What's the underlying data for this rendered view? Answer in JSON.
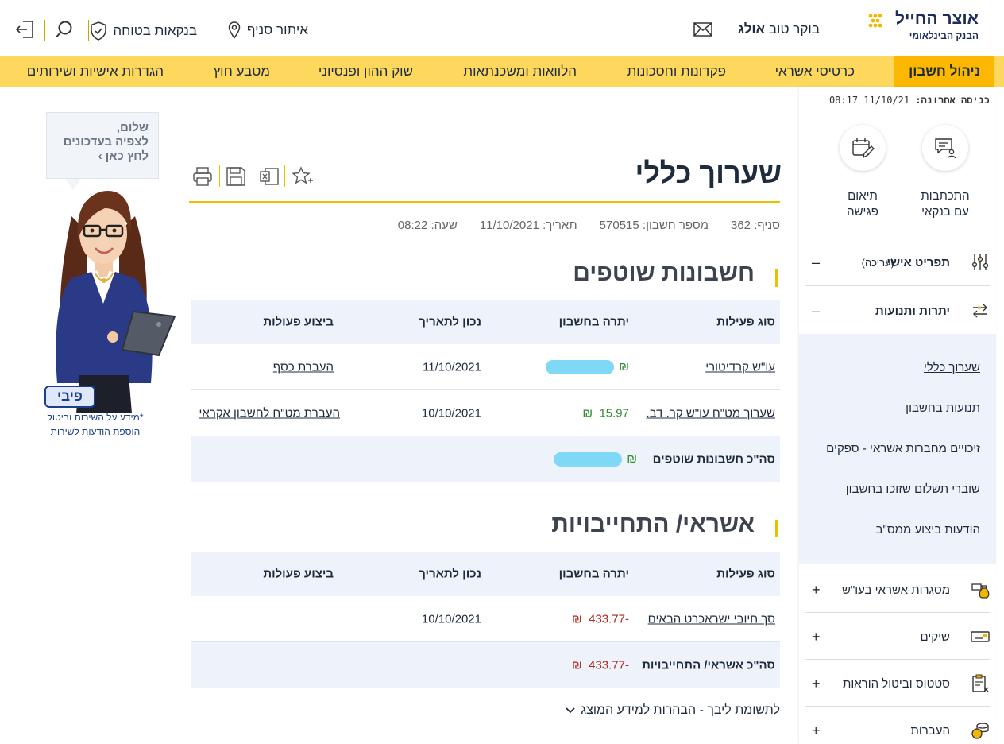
{
  "header": {
    "logo_name": "אוצר החייל",
    "logo_sub": "הבנק הבינלאומי",
    "greeting_prefix": "בוקר טוב",
    "user_name": "אולג",
    "branch_locator": "איתור סניף",
    "secure_banking": "בנקאות בטוחה"
  },
  "nav": {
    "items": [
      "ניהול חשבון",
      "כרטיסי אשראי",
      "פקדונות וחסכונות",
      "הלוואות ומשכנתאות",
      "שוק ההון ופנסיוני",
      "מטבע חוץ",
      "הגדרות אישיות ושירותים"
    ]
  },
  "sidebar": {
    "last_login_label": "כניסה אחרונה:",
    "last_login_date": "11/10/21",
    "last_login_time": "08:17",
    "quick_actions": [
      {
        "line1": "התכתבות",
        "line2": "עם בנקאי",
        "icon": "chat-banker-icon"
      },
      {
        "line1": "תיאום",
        "line2": "פגישה",
        "icon": "calendar-edit-icon"
      }
    ],
    "personal_menu": "תפריט אישי",
    "personal_edit": "(עריכה)",
    "balances": "יתרות ותנועות",
    "submenu": [
      "שערוך כללי",
      "תנועות בחשבון",
      "זיכויים מחברות אשראי - ספקים",
      "שוברי תשלום שזוכו בחשבון",
      "הודעות ביצוע ממס\"ב"
    ],
    "groups": [
      "מסגרות אשראי בעו\"ש",
      "שיקים",
      "סטטוס וביטול הוראות",
      "העברות"
    ],
    "minus": "–",
    "plus": "+"
  },
  "page": {
    "title": "שערוך כללי",
    "branch_label": "סניף:",
    "branch": "362",
    "account_label": "מספר חשבון:",
    "account": "570515",
    "date_label": "תאריך:",
    "date": "11/10/2021",
    "time_label": "שעה:",
    "time": "08:22"
  },
  "table_headers": {
    "type": "סוג פעילות",
    "balance": "יתרה בחשבון",
    "as_of": "נכון לתאריך",
    "actions": "ביצוע פעולות"
  },
  "currency": "₪",
  "shared": {
    "title": "חשבונות שוטפים",
    "rows": [
      {
        "type": "עו\"ש קרדיטורי",
        "balance": "",
        "date": "11/10/2021",
        "action": "העברת כסף"
      },
      {
        "type": "שערוך מט\"ח עו\"ש קר. דב.",
        "balance": "15.97",
        "date": "10/10/2021",
        "action": "העברת מט\"ח לחשבון אקראי"
      }
    ],
    "total_label": "סה\"כ חשבונות שוטפים",
    "total": ""
  },
  "credit": {
    "title": "אשראי/ התחייבויות",
    "rows": [
      {
        "type": "סך חיובי ישראכרט הבאים",
        "balance": "-433.77",
        "date": "10/10/2021",
        "action": ""
      }
    ],
    "total_label": "סה\"כ אשראי/ התחייבויות",
    "total": "-433.77"
  },
  "disclaimer": "לתשומת ליבך - הבהרות למידע המוצג",
  "assistant": {
    "bubble_line1": "שלום,",
    "bubble_line2": "לצפיה בעדכונים",
    "bubble_line3": "לחץ כאן ›",
    "badge": "פיבי",
    "note_line1": "*מידע על השירות וביטול",
    "note_line2": "הוספת הודעות לשירות"
  },
  "colors": {
    "nav_bg": "#fdd85d",
    "nav_active": "#fcb800",
    "accent_line": "#e8c200",
    "positive": "#2f8c2f",
    "negative": "#b0271d",
    "row_highlight": "#eef2fb"
  }
}
